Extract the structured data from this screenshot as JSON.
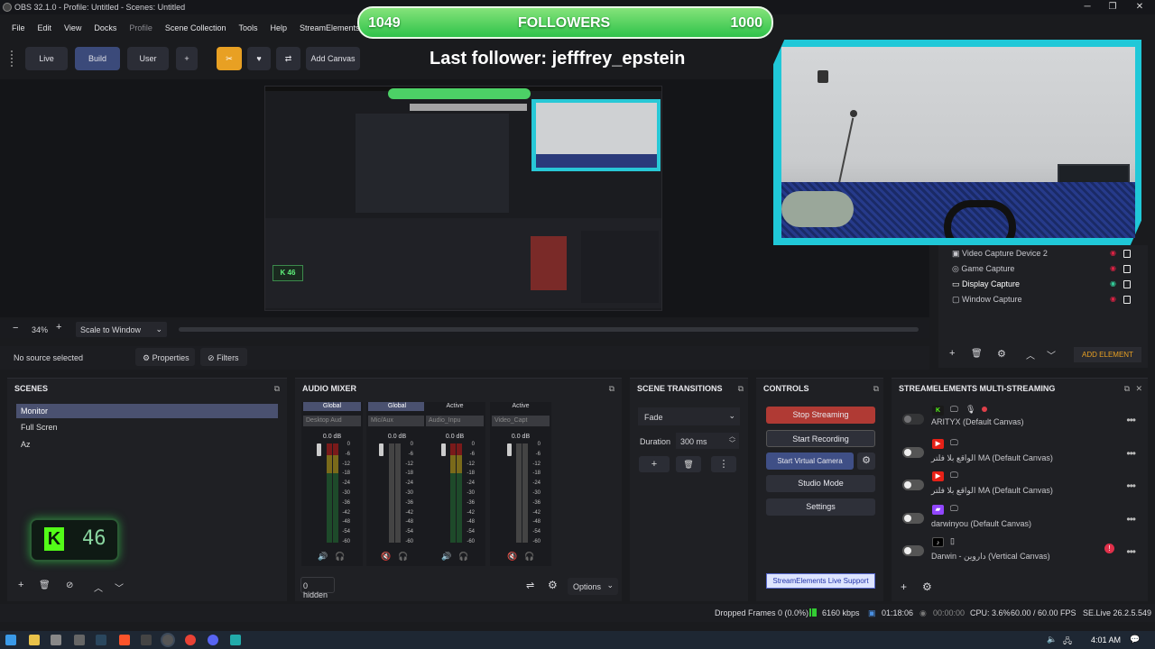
{
  "window": {
    "title": "OBS 32.1.0 - Profile: Untitled - Scenes: Untitled",
    "min": "─",
    "max": "❐",
    "close": "✕"
  },
  "menu": [
    "File",
    "Edit",
    "View",
    "Docks",
    "Profile",
    "Scene Collection",
    "Tools",
    "Help",
    "StreamElements"
  ],
  "toolbar": {
    "live": "Live",
    "build": "Build",
    "user": "User",
    "plus": "+",
    "add_canvas": "Add Canvas"
  },
  "overlay": {
    "followers_left": "1049",
    "followers_label": "FOLLOWERS",
    "followers_right": "1000",
    "last_follower": "Last follower: jefffrey_epstein"
  },
  "preview_bar": {
    "zoom_minus": "−",
    "zoom": "34%",
    "zoom_plus": "+",
    "scale_mode": "Scale to Window"
  },
  "source_bar": {
    "none": "No source selected",
    "properties": "Properties",
    "filters": "Filters"
  },
  "sources": {
    "items": [
      "Video Capture Device 2",
      "Game Capture",
      "Display Capture",
      "Window Capture"
    ],
    "add_element": "ADD ELEMENT"
  },
  "scenes": {
    "title": "SCENES",
    "items": [
      "Monitor",
      "Full Scren",
      "Az"
    ],
    "kick_widget": "46"
  },
  "audio_mixer": {
    "title": "AUDIO MIXER",
    "channels": [
      {
        "label": "Global",
        "device": "Desktop Aud",
        "db": "0.0 dB"
      },
      {
        "label": "Global",
        "device": "Mic/Aux",
        "db": "0.0 dB"
      },
      {
        "label": "Active",
        "device": "Audio_Inpu",
        "db": "0.0 dB"
      },
      {
        "label": "Active",
        "device": "Video_Capt",
        "db": "0.0 dB"
      }
    ],
    "scale": [
      "0",
      "-6",
      "-12",
      "-18",
      "-24",
      "-30",
      "-36",
      "-42",
      "-48",
      "-54",
      "-60"
    ],
    "hidden": "0 hidden",
    "options": "Options"
  },
  "transitions": {
    "title": "SCENE TRANSITIONS",
    "type": "Fade",
    "duration_label": "Duration",
    "duration": "300 ms"
  },
  "controls": {
    "title": "CONTROLS",
    "stop_streaming": "Stop Streaming",
    "start_recording": "Start Recording",
    "start_virtual_camera": "Start Virtual Camera",
    "studio_mode": "Studio Mode",
    "settings": "Settings",
    "support": "StreamElements Live Support"
  },
  "multistream": {
    "title": "STREAMELEMENTS MULTI-STREAMING",
    "rows": [
      {
        "name": "ARITYX (Default Canvas)",
        "icon": "kick-icon",
        "color": "#53fc18"
      },
      {
        "name": "الواقع بلا فلتر MA (Default Canvas)",
        "icon": "youtube-icon",
        "color": "#e62117"
      },
      {
        "name": "الواقع بلا فلتر MA (Default Canvas)",
        "icon": "youtube-icon",
        "color": "#e62117"
      },
      {
        "name": "darwinyou (Default Canvas)",
        "icon": "twitch-icon",
        "color": "#9146ff"
      },
      {
        "name": "Darwin - داروين (Vertical Canvas)",
        "icon": "tiktok-icon",
        "color": "#000000"
      }
    ]
  },
  "status": {
    "dropped": "Dropped Frames 0 (0.0%)",
    "kbps": "6160 kbps",
    "stream_time": "01:18:06",
    "rec_time": "00:00:00",
    "cpu": "CPU: 3.6%",
    "fps": "60.00 / 60.00 FPS",
    "version": "SE.Live 26.2.5.549"
  },
  "taskbar": {
    "time": "4:01 AM"
  }
}
